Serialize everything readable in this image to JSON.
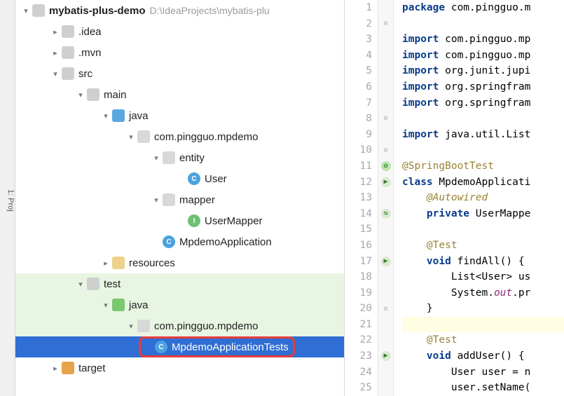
{
  "sidebar": {
    "label": "1: Proj"
  },
  "tree": {
    "root": {
      "name": "mybatis-plus-demo",
      "path": "D:\\IdeaProjects\\mybatis-plu"
    },
    "items": [
      {
        "label": ".idea"
      },
      {
        "label": ".mvn"
      },
      {
        "label": "src"
      },
      {
        "label": "main"
      },
      {
        "label": "java"
      },
      {
        "label": "com.pingguo.mpdemo"
      },
      {
        "label": "entity"
      },
      {
        "label": "User"
      },
      {
        "label": "mapper"
      },
      {
        "label": "UserMapper"
      },
      {
        "label": "MpdemoApplication"
      },
      {
        "label": "resources"
      },
      {
        "label": "test"
      },
      {
        "label": "java"
      },
      {
        "label": "com.pingguo.mpdemo"
      },
      {
        "label": "MpdemoApplicationTests"
      },
      {
        "label": "target"
      }
    ]
  },
  "editor": {
    "lines": [
      {
        "n": 1,
        "html": "<span class='kw'>package</span> com.pingguo.m"
      },
      {
        "n": 2,
        "html": ""
      },
      {
        "n": 3,
        "html": "<span class='kw'>import</span> com.pingguo.mp"
      },
      {
        "n": 4,
        "html": "<span class='kw'>import</span> com.pingguo.mp"
      },
      {
        "n": 5,
        "html": "<span class='kw'>import</span> org.junit.jupi"
      },
      {
        "n": 6,
        "html": "<span class='kw'>import</span> org.springfram"
      },
      {
        "n": 7,
        "html": "<span class='kw'>import</span> org.springfram"
      },
      {
        "n": 8,
        "html": ""
      },
      {
        "n": 9,
        "html": "<span class='kw'>import</span> java.util.List"
      },
      {
        "n": 10,
        "html": ""
      },
      {
        "n": 11,
        "html": "<span class='ann'>@SpringBootTest</span>",
        "marker": "spring"
      },
      {
        "n": 12,
        "html": "<span class='kw'>class</span> MpdemoApplicati",
        "marker": "run"
      },
      {
        "n": 13,
        "html": "    <span class='ann2'>@Autowired</span>"
      },
      {
        "n": 14,
        "html": "    <span class='kw'>private</span> UserMappe",
        "marker": "bean"
      },
      {
        "n": 15,
        "html": ""
      },
      {
        "n": 16,
        "html": "    <span class='ann'>@Test</span>"
      },
      {
        "n": 17,
        "html": "    <span class='kw'>void</span> findAll() {",
        "marker": "run"
      },
      {
        "n": 18,
        "html": "        List&lt;User&gt; us"
      },
      {
        "n": 19,
        "html": "        System.<span class='static'>out</span>.pr"
      },
      {
        "n": 20,
        "html": "    }"
      },
      {
        "n": 21,
        "html": "",
        "current": true
      },
      {
        "n": 22,
        "html": "    <span class='ann'>@Test</span>"
      },
      {
        "n": 23,
        "html": "    <span class='kw'>void</span> addUser() {",
        "marker": "run"
      },
      {
        "n": 24,
        "html": "        User user = n"
      },
      {
        "n": 25,
        "html": "        user.setName("
      }
    ]
  }
}
